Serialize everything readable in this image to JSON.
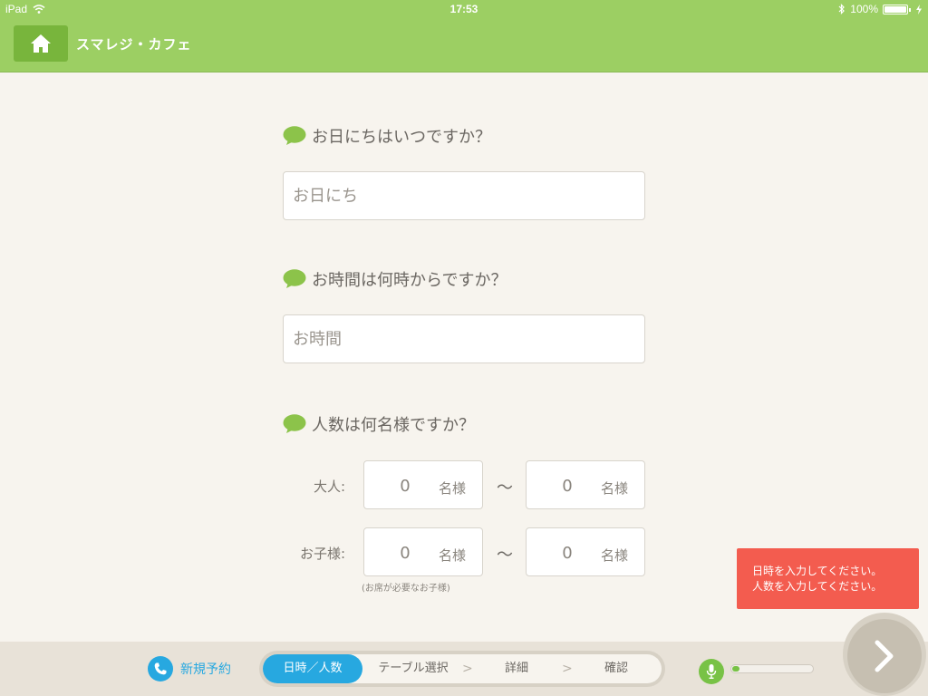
{
  "status_bar": {
    "device": "iPad",
    "time": "17:53",
    "battery_text": "100%",
    "battery_level": 1.0
  },
  "header": {
    "title": "スマレジ・カフェ",
    "home_icon": "home-icon"
  },
  "form": {
    "date_question": "お日にちはいつですか？",
    "date_placeholder": "お日にち",
    "time_question": "お時間は何時からですか？",
    "time_placeholder": "お時間",
    "party_question": "人数は何名様ですか？",
    "adult_label": "大人:",
    "child_label": "お子様:",
    "adult_min": "0",
    "adult_max": "0",
    "child_min": "0",
    "child_max": "0",
    "unit": "名様",
    "range_separator": "〜",
    "child_note": "(お席が必要なお子様)"
  },
  "toast": {
    "line1": "日時を入力してください。",
    "line2": "人数を入力してください。"
  },
  "bottom_bar": {
    "new_reservation": "新規予約",
    "steps": [
      {
        "label": "日時／人数",
        "active": true
      },
      {
        "label": "テーブル選択",
        "active": false
      },
      {
        "label": "詳細",
        "active": false
      },
      {
        "label": "確認",
        "active": false
      }
    ],
    "step_arrow": ">",
    "mic_level": 0.08
  },
  "colors": {
    "header_green": "#9ccf63",
    "home_green": "#78b53c",
    "accent_blue": "#27a8e0",
    "bubble_green": "#8cc34a",
    "toast_red": "#f35c4f",
    "background": "#f7f4ee"
  }
}
